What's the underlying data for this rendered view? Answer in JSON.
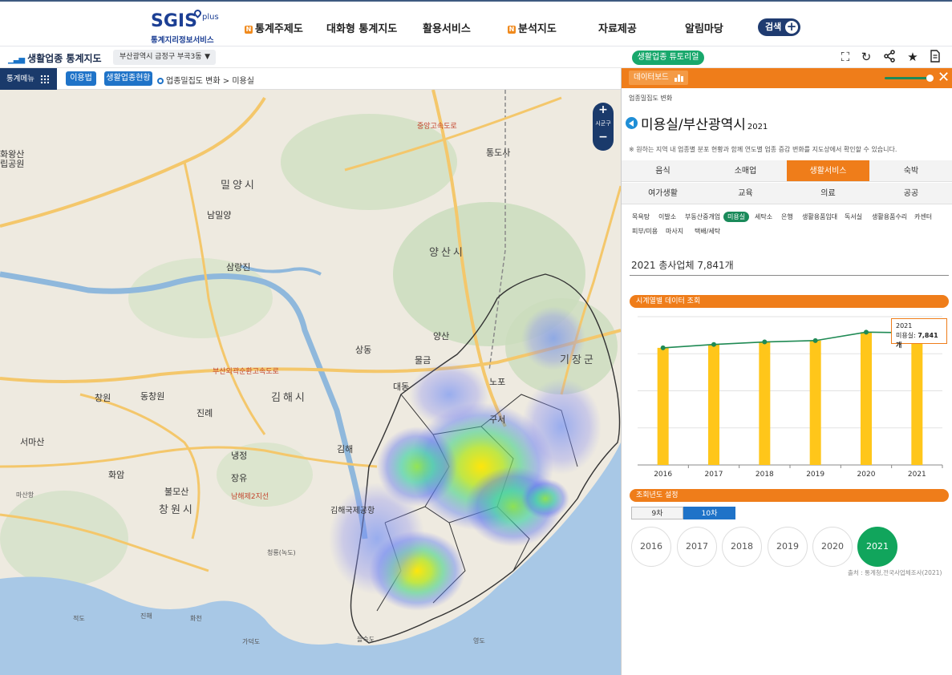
{
  "header": {
    "logo_main": "SGIS",
    "logo_plus": "plus",
    "logo_sub": "통계지리정보서비스",
    "menu": [
      {
        "label": "통계주제도",
        "badge": "N"
      },
      {
        "label": "대화형 통계지도",
        "badge": ""
      },
      {
        "label": "활용서비스",
        "badge": ""
      },
      {
        "label": "분석지도",
        "badge": "N"
      },
      {
        "label": "자료제공",
        "badge": ""
      },
      {
        "label": "알림마당",
        "badge": ""
      }
    ],
    "search_label": "검색"
  },
  "subbar": {
    "title": "생활업종 통계지도",
    "region": "부산광역시 금정구 부곡3동",
    "tutorial": "생활업종 튜토리얼",
    "tools": [
      "fullscreen-icon",
      "refresh-icon",
      "share-icon",
      "bookmark-star-icon",
      "report-icon"
    ]
  },
  "mapbar": {
    "stat_menu": "통계메뉴",
    "btn_usage": "이용법",
    "btn_status": "생활업종현황",
    "breadcrumb": "업종밀집도 변화 > 미용실"
  },
  "map": {
    "zoom_in": "+",
    "zoom_label": "시군구",
    "zoom_out": "−",
    "labels": {
      "miryang": "밀양시",
      "yangsan": "양산시",
      "gimhae": "김해시",
      "changwon": "창원시",
      "gijang": "기장군",
      "namiryang": "남밀양",
      "samnangjin": "삼랑진",
      "sangdong": "상동",
      "mulgeum": "물금",
      "yangsan_ic": "양산",
      "daedong": "대동",
      "nopo": "노포",
      "gimhae_ic": "김해",
      "jinrye": "진례",
      "dongchangwon": "동창원",
      "changwon_ic": "창원",
      "seomasan": "서마산",
      "naengjeong": "냉정",
      "jangyu": "장유",
      "hwaam": "화암",
      "buemosan": "불모산",
      "airport": "김해국제공항",
      "guseo": "구서",
      "tongdosa": "통도사",
      "gaduk": "가덕도",
      "masan": "마산항",
      "jinhae": "진해",
      "eulsuk": "을숙도",
      "yeongdo": "영도",
      "jeokdo": "적도",
      "hakcheon": "화천",
      "busan_outer": "부산외곽순환고속도로",
      "jungang": "중앙고속도로",
      "namhae": "남해제2지선",
      "nakdong": "청룡(녹도)",
      "park": "화왕산",
      "gonju": "립공원"
    }
  },
  "panel": {
    "head_label": "데이터보드",
    "crumb": "업종밀집도 변화",
    "title": "미용실/부산광역시",
    "title_year": "2021",
    "notice": "※ 원하는 지역 내 업종별 분포 현황과 함께 연도별 업종 증감 변화를 지도상에서 확인할 수 있습니다.",
    "categories": [
      "음식",
      "소매업",
      "생활서비스",
      "숙박",
      "여가생활",
      "교육",
      "의료",
      "공공"
    ],
    "active_category": "생활서비스",
    "subcategories": [
      "목욕탕",
      "이발소",
      "부동산중개업",
      "미용실",
      "세탁소",
      "은행",
      "생활용품임대",
      "독서실",
      "생활용품수리",
      "카센터",
      "피부/미용",
      "마사지",
      "택배/세탁"
    ],
    "active_subcategory": "미용실",
    "total_text": "2021 총사업체 7,841개",
    "section_timeseries": "시계열별 데이터 조회",
    "tooltip_year": "2021",
    "tooltip_label": "미용실:",
    "tooltip_value": "7,841개",
    "section_year": "조회년도 설정",
    "round_tabs": [
      "9차",
      "10차"
    ],
    "active_round": "10차",
    "years": [
      "2016",
      "2017",
      "2018",
      "2019",
      "2020",
      "2021"
    ],
    "active_year": "2021",
    "source": "출처 : 통계청,전국사업체조사(2021)"
  },
  "chart_data": {
    "type": "bar",
    "categories": [
      "2016",
      "2017",
      "2018",
      "2019",
      "2020",
      "2021"
    ],
    "series": [
      {
        "name": "미용실",
        "values": [
          6950,
          7150,
          7300,
          7380,
          7880,
          7841
        ]
      }
    ],
    "line_overlay": true,
    "ylim": [
      0,
      8800
    ],
    "grid": true,
    "bar_color": "#ffc61a",
    "line_color": "#1f8a54",
    "title": "",
    "xlabel": "",
    "ylabel": ""
  },
  "colors": {
    "accent_orange": "#ef7d1a",
    "nav_blue": "#1a3a6b",
    "active_green": "#11a55c",
    "button_blue": "#1f73c8"
  }
}
